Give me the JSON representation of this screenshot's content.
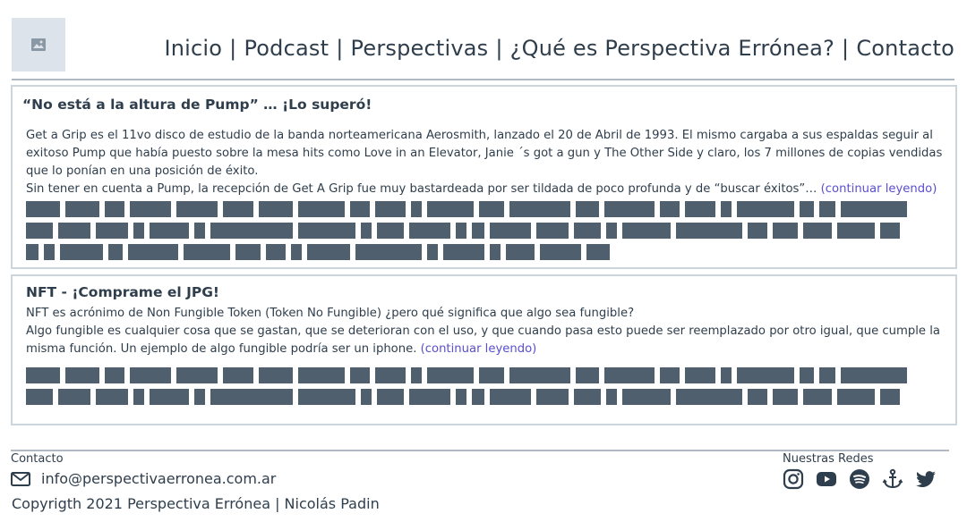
{
  "header": {
    "logo_icon": "image-placeholder-icon",
    "nav": [
      "Inicio",
      "Podcast",
      "Perspectivas",
      "¿Qué es Perspectiva Errónea?",
      "Contacto"
    ],
    "separator": "|"
  },
  "posts": [
    {
      "title": "“No está a la altura de Pump” … ¡Lo superó!",
      "paragraph1": "Get a Grip es el 11vo disco de estudio de la banda norteamericana Aerosmith, lanzado el 20 de Abril de 1993. El mismo cargaba a sus espaldas seguir al exitoso Pump que había puesto sobre la mesa hits como Love in an Elevator, Janie ´s got a gun y The Other Side y claro, los 7 millones de copias vendidas que lo ponían en una posición de éxito.",
      "paragraph2": "Sin tener en cuenta a Pump, la recepción de Get A Grip fue muy bastardeada por ser tildada de poco profunda y de “buscar éxitos”…  ",
      "more_label": "(continuar leyendo)"
    },
    {
      "title": "NFT - ¡Comprame el JPG!",
      "paragraph1": "NFT es acrónimo de Non Fungible Token (Token No Fungible) ¿pero qué significa que algo sea fungible?",
      "paragraph2": "Algo fungible es cualquier cosa que se gastan, que se deterioran con el uso, y que cuando pasa esto puede ser reemplazado por otro igual, que cumple la misma función.  Un ejemplo de algo fungible podría ser un iphone.  ",
      "more_label": "(continuar leyendo)"
    }
  ],
  "footer": {
    "contact_label": "Contacto",
    "email": "info@perspectivaerronea.com.ar",
    "copyright": "Copyrigth 2021 Perspectiva Errónea | Nicolás Padin",
    "social_label": "Nuestras Redes",
    "social_icons": [
      "instagram-icon",
      "youtube-icon",
      "spotify-icon",
      "anchor-icon",
      "twitter-icon"
    ]
  }
}
